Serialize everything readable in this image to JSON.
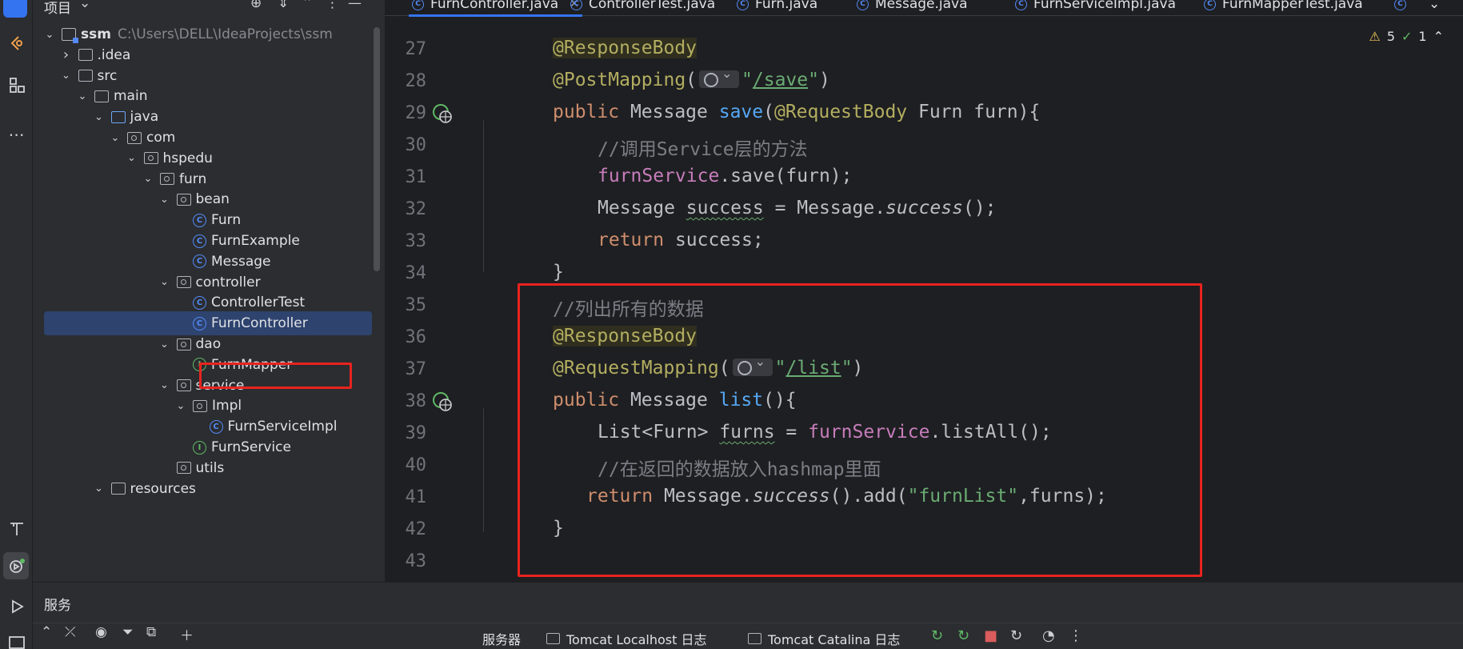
{
  "project_panel": {
    "title": "项目",
    "title_chevron": "⌄",
    "header_icons": [
      "target-icon",
      "expand-collapse-icon",
      "collapse-icon",
      "more-icon",
      "minimize-icon"
    ],
    "root": {
      "name": "ssm",
      "path": "C:\\Users\\DELL\\IdeaProjects\\ssm"
    },
    "tree": [
      {
        "label": "ssm",
        "type": "module",
        "depth": 0,
        "expanded": true
      },
      {
        "label": ".idea",
        "type": "folder",
        "depth": 1,
        "expanded": false
      },
      {
        "label": "src",
        "type": "folder",
        "depth": 1,
        "expanded": true
      },
      {
        "label": "main",
        "type": "folder",
        "depth": 2,
        "expanded": true
      },
      {
        "label": "java",
        "type": "source-folder",
        "depth": 3,
        "expanded": true
      },
      {
        "label": "com",
        "type": "package",
        "depth": 4,
        "expanded": true
      },
      {
        "label": "hspedu",
        "type": "package",
        "depth": 5,
        "expanded": true
      },
      {
        "label": "furn",
        "type": "package",
        "depth": 6,
        "expanded": true
      },
      {
        "label": "bean",
        "type": "package",
        "depth": 7,
        "expanded": true
      },
      {
        "label": "Furn",
        "type": "class",
        "depth": 8
      },
      {
        "label": "FurnExample",
        "type": "class",
        "depth": 8
      },
      {
        "label": "Message",
        "type": "class",
        "depth": 8
      },
      {
        "label": "controller",
        "type": "package",
        "depth": 7,
        "expanded": true
      },
      {
        "label": "ControllerTest",
        "type": "class",
        "depth": 8
      },
      {
        "label": "FurnController",
        "type": "class",
        "depth": 8,
        "selected": true
      },
      {
        "label": "dao",
        "type": "package",
        "depth": 7,
        "expanded": true
      },
      {
        "label": "FurnMapper",
        "type": "interface",
        "depth": 8
      },
      {
        "label": "service",
        "type": "package",
        "depth": 7,
        "expanded": true
      },
      {
        "label": "Impl",
        "type": "package",
        "depth": 8,
        "expanded": true
      },
      {
        "label": "FurnServiceImpl",
        "type": "class",
        "depth": 9
      },
      {
        "label": "FurnService",
        "type": "interface",
        "depth": 8
      },
      {
        "label": "utils",
        "type": "package",
        "depth": 7
      },
      {
        "label": "resources",
        "type": "folder",
        "depth": 3,
        "expanded": true
      }
    ]
  },
  "editor": {
    "tabs": [
      {
        "label": "FurnController.java",
        "active": true,
        "closable": true
      },
      {
        "label": "ControllerTest.java"
      },
      {
        "label": "Furn.java"
      },
      {
        "label": "Message.java"
      },
      {
        "label": "FurnServiceImpl.java"
      },
      {
        "label": "FurnMapperTest.java"
      }
    ],
    "tabs_overflow": "⌄",
    "inspections": {
      "warnings": "5",
      "weak_warnings": "1"
    },
    "lines": [
      {
        "n": "27",
        "text": "@ResponseBody"
      },
      {
        "n": "28",
        "text": "@PostMapping(\"/save\")"
      },
      {
        "n": "29",
        "text": "public Message save(@RequestBody Furn furn){"
      },
      {
        "n": "30",
        "text": "//调用Service层的方法"
      },
      {
        "n": "31",
        "text": "furnService.save(furn);"
      },
      {
        "n": "32",
        "text": "Message success = Message.success();"
      },
      {
        "n": "33",
        "text": "return success;"
      },
      {
        "n": "34",
        "text": "}"
      },
      {
        "n": "35",
        "text": "//列出所有的数据"
      },
      {
        "n": "36",
        "text": "@ResponseBody"
      },
      {
        "n": "37",
        "text": "@RequestMapping(\"/list\")"
      },
      {
        "n": "38",
        "text": "public Message list(){"
      },
      {
        "n": "39",
        "text": "List<Furn> furns = furnService.listAll();"
      },
      {
        "n": "40",
        "text": "//在返回的数据放入hashmap里面"
      },
      {
        "n": "41",
        "text": "return Message.success().add(\"furnList\",furns);"
      },
      {
        "n": "42",
        "text": "}"
      },
      {
        "n": "43",
        "text": ""
      }
    ]
  },
  "services_panel": {
    "title": "服务",
    "toolbar_icons": [
      "expand-all-icon",
      "collapse-all-icon",
      "eye-icon",
      "filter-icon",
      "new-group-icon",
      "add-icon"
    ],
    "tabs": [
      "服务器",
      "Tomcat Localhost 日志",
      "Tomcat Catalina 日志"
    ],
    "actions": [
      "rerun-icon",
      "rerun-debug-icon",
      "stop-icon",
      "refresh-icon",
      "profiler-icon",
      "more-icon"
    ]
  },
  "colors": {
    "accent": "#3574f0",
    "highlight_box": "#e8231f",
    "selection": "#2e436e",
    "keyword": "#cf8e6d",
    "annotation": "#b3ae60",
    "string": "#6aab73",
    "comment": "#7a7e85",
    "method": "#56a8f5",
    "field": "#c77dbb"
  }
}
